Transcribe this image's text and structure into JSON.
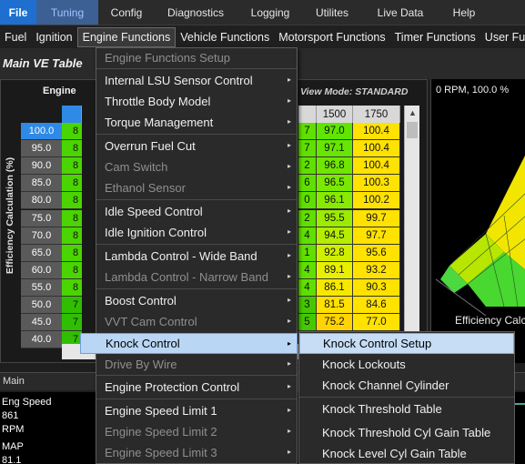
{
  "menubar_top": {
    "tabs": [
      "File",
      "Tuning",
      "Config",
      "Diagnostics",
      "Logging",
      "Utilites",
      "Live Data",
      "Help"
    ]
  },
  "menubar_secondary": {
    "items": [
      "Fuel",
      "Ignition",
      "Engine Functions",
      "Vehicle Functions",
      "Motorsport Functions",
      "Timer Functions",
      "User Fu"
    ],
    "active": "Engine Functions"
  },
  "window_title": "Main VE Table",
  "table": {
    "header_left": "Engine",
    "view_mode": "View Mode: STANDARD",
    "y_axis_label": "Efficiency Calculation (%)",
    "col_headers": [
      "1500",
      "1750"
    ],
    "rows": [
      {
        "load": "100.0",
        "c0": "8",
        "c1": "7",
        "v1500": "97.0",
        "v1750": "100.4"
      },
      {
        "load": "95.0",
        "c0": "8",
        "c1": "7",
        "v1500": "97.1",
        "v1750": "100.4"
      },
      {
        "load": "90.0",
        "c0": "8",
        "c1": "2",
        "v1500": "96.8",
        "v1750": "100.4"
      },
      {
        "load": "85.0",
        "c0": "8",
        "c1": "6",
        "v1500": "96.5",
        "v1750": "100.3"
      },
      {
        "load": "80.0",
        "c0": "8",
        "c1": "0",
        "v1500": "96.1",
        "v1750": "100.2"
      },
      {
        "load": "75.0",
        "c0": "8",
        "c1": "2",
        "v1500": "95.5",
        "v1750": "99.7"
      },
      {
        "load": "70.0",
        "c0": "8",
        "c1": "4",
        "v1500": "94.5",
        "v1750": "97.7"
      },
      {
        "load": "65.0",
        "c0": "8",
        "c1": "1",
        "v1500": "92.8",
        "v1750": "95.6"
      },
      {
        "load": "60.0",
        "c0": "8",
        "c1": "4",
        "v1500": "89.1",
        "v1750": "93.2"
      },
      {
        "load": "55.0",
        "c0": "8",
        "c1": "4",
        "v1500": "86.1",
        "v1750": "90.3"
      },
      {
        "load": "50.0",
        "c0": "7",
        "c1": "3",
        "v1500": "81.5",
        "v1750": "84.6"
      },
      {
        "load": "45.0",
        "c0": "7",
        "c1": "5",
        "v1500": "75.2",
        "v1750": "77.0"
      },
      {
        "load": "40.0",
        "c0": "7",
        "c1": "",
        "v1500": "",
        "v1750": ""
      }
    ]
  },
  "panel3d": {
    "status": "0 RPM, 100.0 %",
    "caption": "Efficiency Calc"
  },
  "bottom": {
    "main_label": "Main",
    "gauges": [
      "Eng Speed",
      "861",
      "RPM",
      "MAP",
      "81.1"
    ]
  },
  "dropdown": {
    "items": [
      {
        "label": "Engine Functions Setup",
        "enabled": false,
        "arrow": ""
      },
      {
        "label": "Internal LSU Sensor Control",
        "enabled": true,
        "arrow": "▸"
      },
      {
        "label": "Throttle Body Model",
        "enabled": true,
        "arrow": "▸"
      },
      {
        "label": "Torque Management",
        "enabled": true,
        "arrow": "▸"
      },
      {
        "label": "Overrun Fuel Cut",
        "enabled": true,
        "arrow": "▸"
      },
      {
        "label": "Cam Switch",
        "enabled": false,
        "arrow": "▸"
      },
      {
        "label": "Ethanol Sensor",
        "enabled": false,
        "arrow": "▸"
      },
      {
        "label": "Idle Speed Control",
        "enabled": true,
        "arrow": "▸"
      },
      {
        "label": "Idle Ignition Control",
        "enabled": true,
        "arrow": "▸"
      },
      {
        "label": "Lambda Control - Wide Band",
        "enabled": true,
        "arrow": "▸"
      },
      {
        "label": "Lambda Control - Narrow Band",
        "enabled": false,
        "arrow": "▸"
      },
      {
        "label": "Boost Control",
        "enabled": true,
        "arrow": "▸"
      },
      {
        "label": "VVT Cam Control",
        "enabled": false,
        "arrow": "▸"
      },
      {
        "label": "Knock Control",
        "enabled": true,
        "arrow": "▸"
      },
      {
        "label": "Drive By Wire",
        "enabled": false,
        "arrow": "▸"
      },
      {
        "label": "Engine Protection Control",
        "enabled": true,
        "arrow": "▸"
      },
      {
        "label": "Engine Speed Limit 1",
        "enabled": true,
        "arrow": "▸"
      },
      {
        "label": "Engine Speed Limit 2",
        "enabled": false,
        "arrow": "▸"
      },
      {
        "label": "Engine Speed Limit 3",
        "enabled": false,
        "arrow": "▸"
      }
    ],
    "highlighted": "Knock Control"
  },
  "submenu": {
    "items": [
      "Knock Control Setup",
      "Knock Lockouts",
      "Knock Channel Cylinder",
      "Knock Threshold Table",
      "Knock Threshold Cyl Gain Table",
      "Knock Level Cyl Gain Table"
    ],
    "highlighted": "Knock Control Setup"
  },
  "colors": {
    "file_tab": "#1e6fd0",
    "tuning_tab": "#3c5f94",
    "selected_row_header": "#2e8ae6",
    "menu_highlight": "#b9d7f5"
  }
}
